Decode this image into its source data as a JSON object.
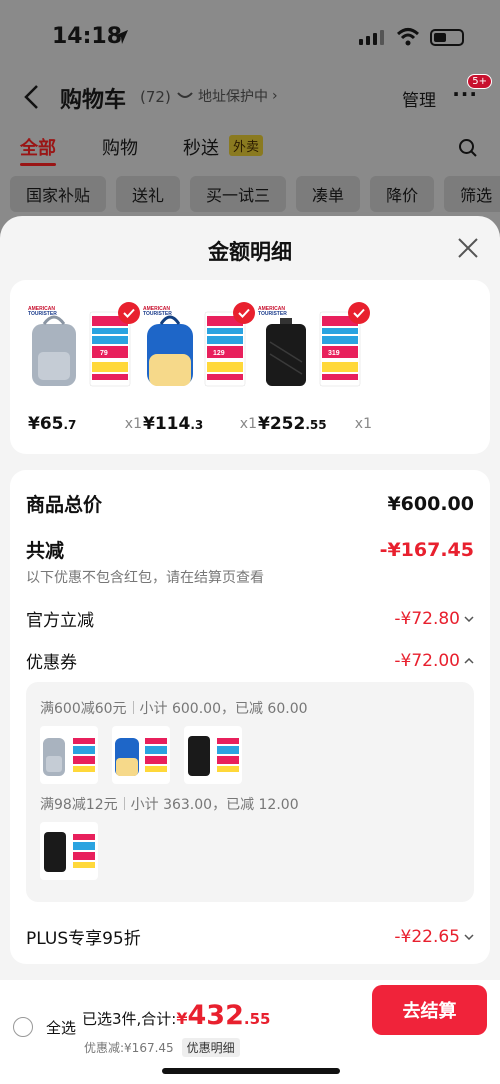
{
  "status_bar": {
    "time": "14:18"
  },
  "nav": {
    "title": "购物车",
    "count": "(72)",
    "address_protect": "地址保护中",
    "manage": "管理",
    "more_badge": "5+"
  },
  "tabs": [
    {
      "label": "全部",
      "active": true
    },
    {
      "label": "购物",
      "active": false
    },
    {
      "label": "秒送",
      "active": false
    }
  ],
  "tabs_hot_badge": "外卖",
  "chips": [
    "国家补贴",
    "送礼",
    "买一试三",
    "凑单",
    "降价",
    "筛选"
  ],
  "sheet": {
    "title": "金额明细",
    "products": [
      {
        "price_int": "¥65",
        "price_dec": ".7",
        "qty": "x1",
        "color": "#a9b3bf",
        "tag_price": "79"
      },
      {
        "price_int": "¥114",
        "price_dec": ".3",
        "qty": "x1",
        "color": "#1e66c8",
        "tag_price": "129"
      },
      {
        "price_int": "¥252",
        "price_dec": ".55",
        "qty": "x1",
        "color": "#1a1a1a",
        "tag_price": "319"
      }
    ],
    "total_label": "商品总价",
    "total_value": "¥600.00",
    "discount_label": "共减",
    "discount_value": "-¥167.45",
    "discount_note": "以下优惠不包含红包，请在结算页查看",
    "official_label": "官方立减",
    "official_value": "-¥72.80",
    "coupon_label": "优惠券",
    "coupon_value": "-¥72.00",
    "coupon_groups": [
      {
        "rule": "满600减60元",
        "summary": "小计 600.00，已减 60.00"
      },
      {
        "rule": "满98减12元",
        "summary": "小计 363.00，已减 12.00"
      }
    ],
    "plus_label": "PLUS专享95折",
    "plus_value": "-¥22.65"
  },
  "footer": {
    "select_all": "全选",
    "selected_text": "已选3件,合计:",
    "currency": "¥",
    "total_int": "432",
    "total_dec": ".55",
    "discount_text": "优惠减:¥167.45",
    "detail_tag": "优惠明细",
    "checkout": "去结算"
  },
  "colors": {
    "accent": "#e8202e",
    "checkout_bg": "#f0233a"
  },
  "thumb_mini_price": "79"
}
